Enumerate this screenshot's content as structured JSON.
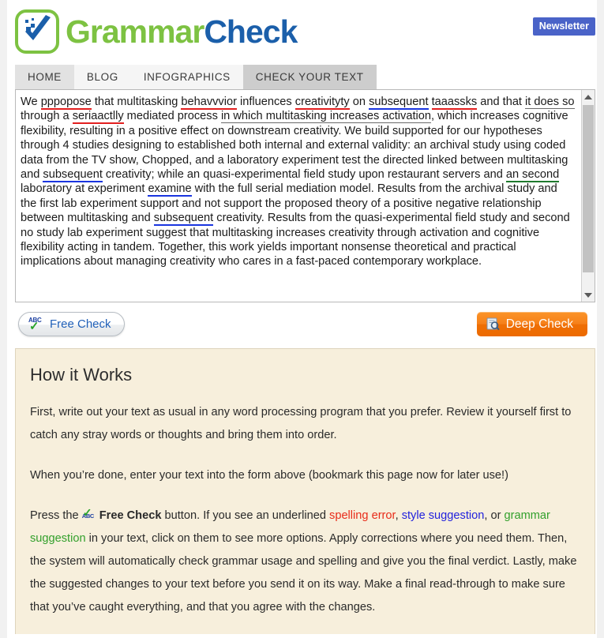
{
  "brand": {
    "name_part1": "Grammar",
    "name_part2": "Check",
    "logo_icon": "green-rounded-square-with-blue-checkmark",
    "green": "#7dc242",
    "blue": "#1b5faa"
  },
  "header": {
    "newsletter_label": "Newsletter",
    "newsletter_color": "#4a63c8"
  },
  "nav": {
    "tabs": [
      {
        "label": "HOME",
        "active": false
      },
      {
        "label": "BLOG",
        "active": false
      },
      {
        "label": "INFOGRAPHICS",
        "active": false
      },
      {
        "label": "CHECK YOUR TEXT",
        "active": true
      }
    ]
  },
  "editor": {
    "line1_a": "We ",
    "sp_pppopose": "pppopose",
    "line1_b": " that multitasking ",
    "sp_behavvvior": "behavvvior",
    "line1_c": " influences ",
    "sp_creativityty": "creativityty",
    "line1_d": " on ",
    "st_subsequent1": "subsequent",
    "line1_e": " ",
    "sp_taaassks": "taaassks",
    "line1_f": " and that ",
    "gr_itdoesso": "it does so",
    "line2_a": " through a ",
    "sp_seriaactlly": "seriaactlly",
    "line2_b": " mediated process ",
    "gr_inwhich": "in which multitasking increases activation",
    "line2_c": ", which increases cognitive flexibility, resulting in a positive effect on downstream creativity. We build supported for our hypotheses through 4 studies designing to established both internal and external validity: an archival study using coded data from the TV show, Chopped, and a laboratory experiment test the directed linked between multitasking and ",
    "st_subsequent2": "subsequent",
    "line3_a": " creativity; while an quasi-experimental field study upon restaurant servers and ",
    "gr_ansecond": "an second",
    "line3_b": " laboratory at experiment ",
    "st_examine": "examine",
    "line3_c": " with the full serial mediation model. Results from the archival study and the first lab experiment support and not support the proposed theory of a positive negative relationship between multitasking and ",
    "st_subsequent3": "subsequent",
    "line4_a": " creativity. Results from the quasi-experimental field study and second no study lab experiment suggest that multitasking increases creativity through activation and cognitive flexibility acting in tandem. Together, this work yields important nonsense theoretical and practical implications about managing creativity who cares in a fast-paced contemporary workplace.",
    "underline_colors": {
      "spelling": "#e21f1f",
      "style": "#1a35e0",
      "grammar": "#1f7a2e",
      "plain": "#6b6b6b"
    }
  },
  "actions": {
    "free_check_label": "Free Check",
    "free_check_icon": "abc-checkmark-icon",
    "deep_check_label": "Deep Check",
    "deep_check_icon": "magnifier-document-icon",
    "deep_check_color": "#ef6f05"
  },
  "how_it_works": {
    "title": "How it Works",
    "p1": "First, write out your text as usual in any word processing program that you prefer. Review it yourself first to catch any stray words or thoughts and bring them into order.",
    "p2": "When you’re done, enter your text into the form above (bookmark this page now for later use!)",
    "p3_a": "Press the ",
    "p3_button": "Free Check",
    "p3_b": " button. If you see an underlined ",
    "p3_spelling": "spelling error",
    "p3_c": ", ",
    "p3_style": "style suggestion",
    "p3_d": ", or ",
    "p3_grammar": "grammar suggestion",
    "p3_e": " in your text, click on them to see more options. Apply corrections where you need them. Then, the system will automatically check grammar usage and spelling and give you the final verdict. Lastly, make the suggested changes to your text before you send it on its way. Make a final read-through to make sure that you’ve caught everything, and that you agree with the changes."
  }
}
